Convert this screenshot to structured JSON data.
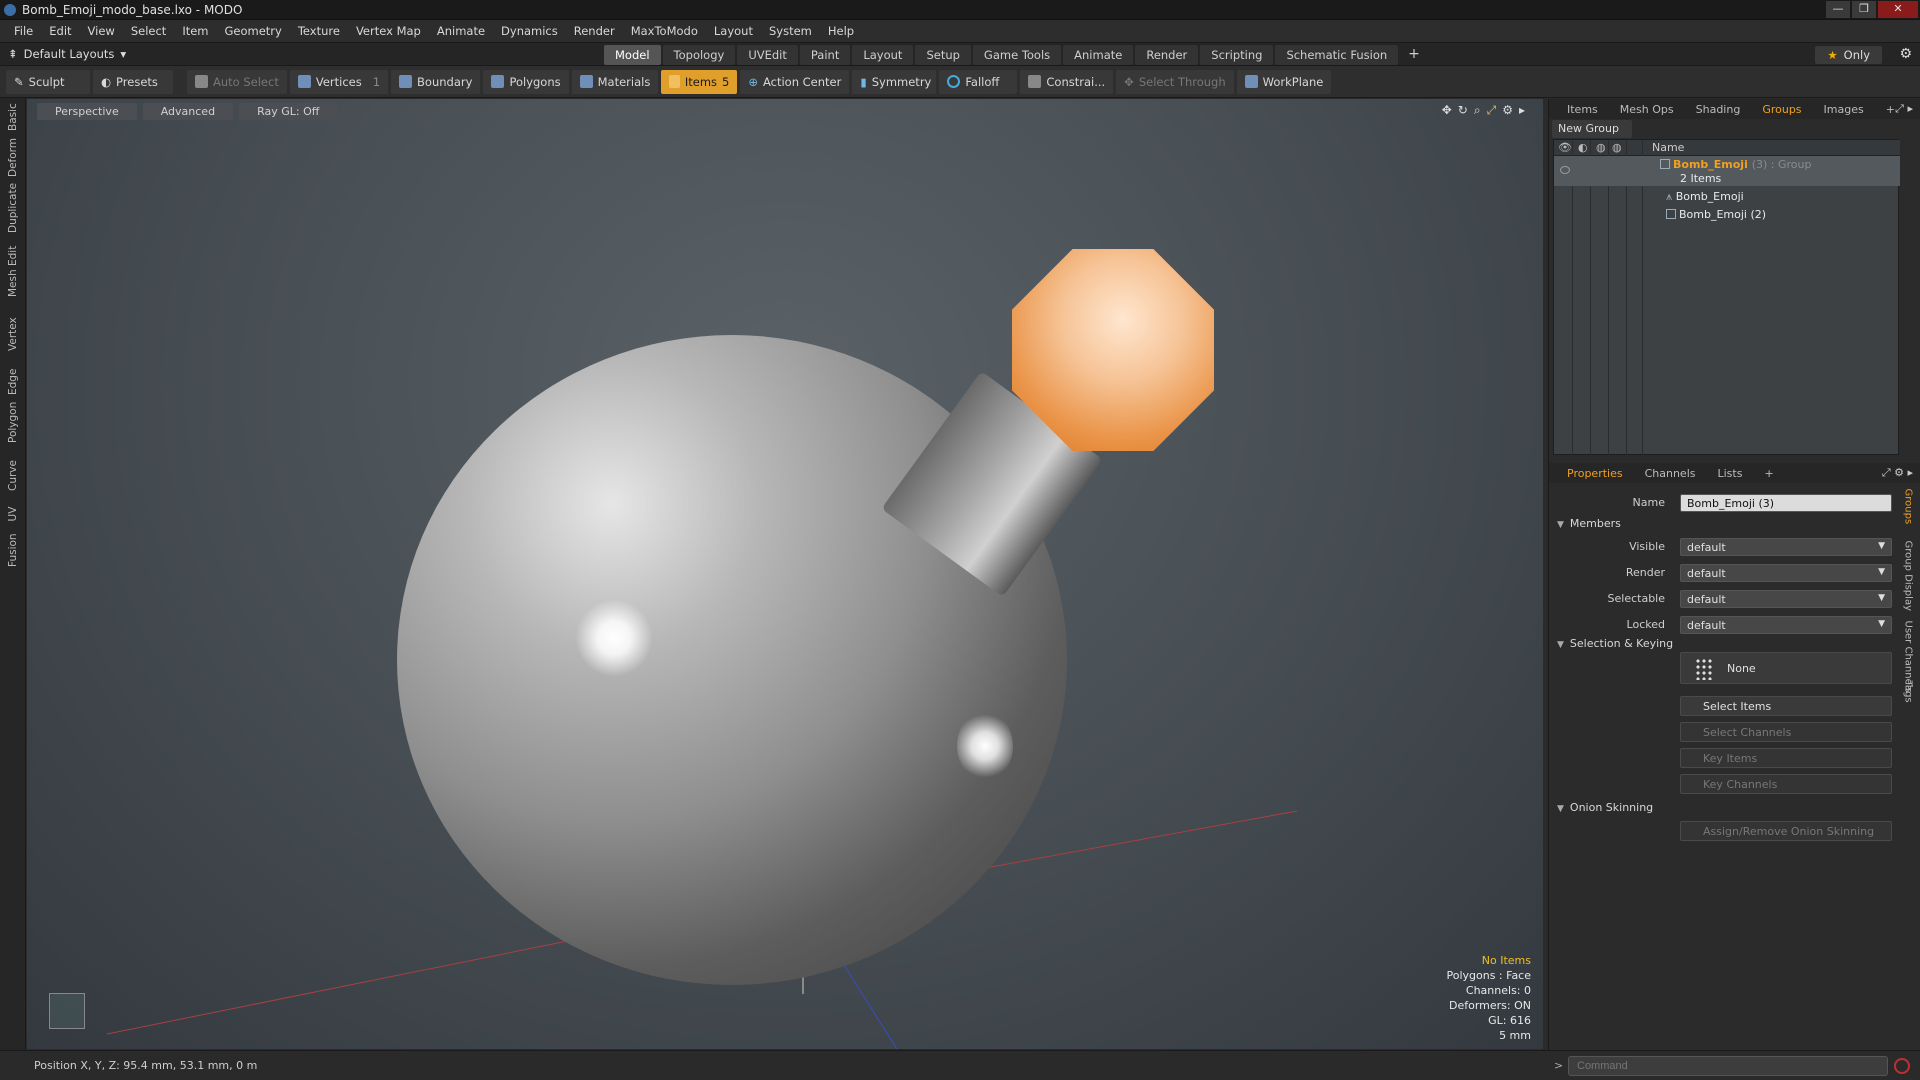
{
  "window": {
    "title": "Bomb_Emoji_modo_base.lxo - MODO"
  },
  "menu": [
    "File",
    "Edit",
    "View",
    "Select",
    "Item",
    "Geometry",
    "Texture",
    "Vertex Map",
    "Animate",
    "Dynamics",
    "Render",
    "MaxToModo",
    "Layout",
    "System",
    "Help"
  ],
  "layout": {
    "default_layouts": "Default Layouts",
    "tabs": [
      "Model",
      "Topology",
      "UVEdit",
      "Paint",
      "Layout",
      "Setup",
      "Game Tools",
      "Animate",
      "Render",
      "Scripting",
      "Schematic Fusion"
    ],
    "active_tab": "Model",
    "only": "Only"
  },
  "toolbar": {
    "sculpt": "Sculpt",
    "presets": "Presets",
    "auto_select": "Auto Select",
    "vertices": "Vertices",
    "vertices_count": "1",
    "boundary": "Boundary",
    "polygons": "Polygons",
    "materials": "Materials",
    "items": "Items",
    "items_count": "5",
    "action_center": "Action Center",
    "symmetry": "Symmetry",
    "falloff": "Falloff",
    "constrain": "Constrai...",
    "select_through": "Select Through",
    "workplane": "WorkPlane"
  },
  "left_tabs": [
    "Basic",
    "Deform",
    "Duplicate",
    "Mesh Edit",
    "Vertex",
    "Edge",
    "Polygon",
    "Curve",
    "UV",
    "Fusion"
  ],
  "viewport": {
    "tabs": [
      "Perspective",
      "Advanced",
      "Ray GL: Off"
    ],
    "hud": {
      "no_items": "No Items",
      "polygons": "Polygons : Face",
      "channels": "Channels: 0",
      "deformers": "Deformers: ON",
      "gl": "GL: 616",
      "scale": "5 mm"
    }
  },
  "status": {
    "position": "Position X, Y, Z:  95.4 mm, 53.1 mm, 0 m"
  },
  "panel_top": {
    "tabs": [
      "Items",
      "Mesh Ops",
      "Shading",
      "Groups",
      "Images"
    ],
    "active": "Groups",
    "new_group": "New Group",
    "header_name": "Name",
    "group_name": "Bomb_Emoji",
    "group_suffix": "(3) : Group",
    "group_count": "2 Items",
    "children": [
      "Bomb_Emoji",
      "Bomb_Emoji (2)"
    ]
  },
  "panel_bottom": {
    "tabs": [
      "Properties",
      "Channels",
      "Lists"
    ],
    "active": "Properties",
    "name_label": "Name",
    "name_value": "Bomb_Emoji (3)",
    "members": "Members",
    "visible_label": "Visible",
    "visible_value": "default",
    "render_label": "Render",
    "render_value": "default",
    "selectable_label": "Selectable",
    "selectable_value": "default",
    "locked_label": "Locked",
    "locked_value": "default",
    "selection_keying": "Selection & Keying",
    "none": "None",
    "select_items": "Select Items",
    "select_channels": "Select Channels",
    "key_items": "Key Items",
    "key_channels": "Key Channels",
    "onion_skinning": "Onion Skinning",
    "assign_onion": "Assign/Remove Onion Skinning",
    "side_tabs": [
      "Groups",
      "Group Display",
      "User Channels",
      "Tags"
    ]
  },
  "command": {
    "placeholder": "Command"
  }
}
